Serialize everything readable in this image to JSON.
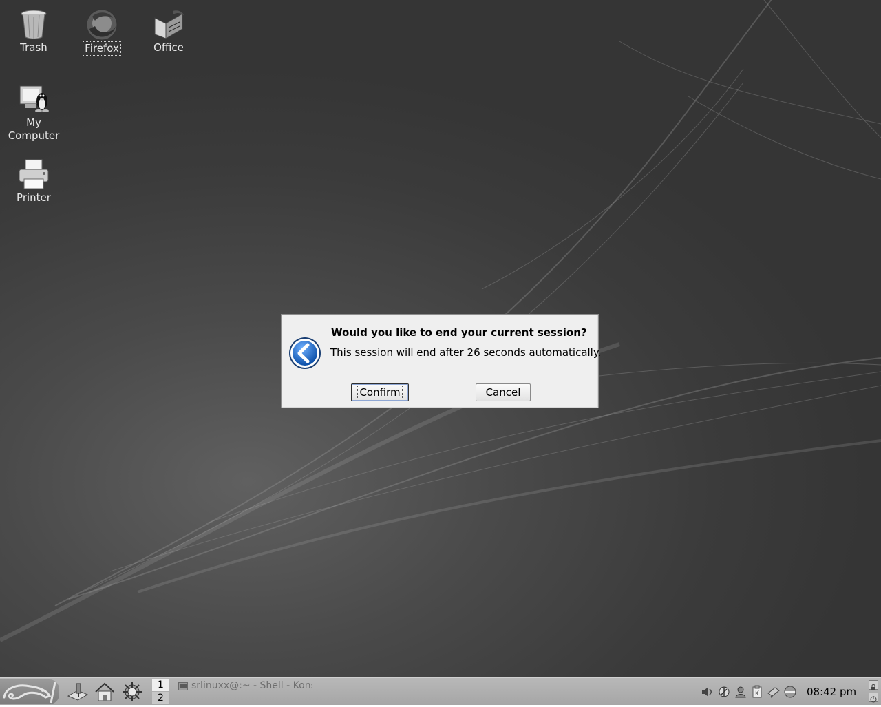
{
  "desktop": {
    "icons": [
      {
        "label": "Trash",
        "icon": "trash-icon"
      },
      {
        "label": "Firefox",
        "icon": "firefox-icon"
      },
      {
        "label": "Office",
        "icon": "office-icon"
      },
      {
        "label": "My Computer",
        "icon": "computer-icon"
      },
      {
        "label": "Printer",
        "icon": "printer-icon"
      }
    ]
  },
  "dialog": {
    "title": "Would you like to end your current session?",
    "message": "This session will end after 26 seconds automatically.",
    "confirm_label": "Confirm",
    "cancel_label": "Cancel",
    "icon": "logout-arrow-icon"
  },
  "panel": {
    "pager": [
      "1",
      "2"
    ],
    "task_label": "srlinuxx@:~ - Shell - Konsole",
    "clock": "08:42 pm",
    "tray_icons": [
      "volume-icon",
      "network-icon",
      "user-icon",
      "klipper-icon",
      "battery-icon",
      "update-icon"
    ]
  },
  "colors": {
    "desktop_bg": "#3b3b3b",
    "dialog_bg": "#efefef",
    "panel_bg": "#b0b0b0",
    "accent_blue": "#1c66c2"
  }
}
